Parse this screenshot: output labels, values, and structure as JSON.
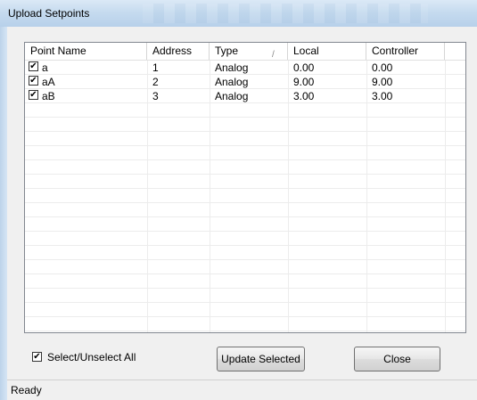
{
  "window": {
    "title": "Upload Setpoints"
  },
  "list": {
    "columns": [
      "Point Name",
      "Address",
      "Type",
      "Local",
      "Controller"
    ],
    "sort_indicator": "/",
    "rows": [
      {
        "checked": true,
        "name": "a",
        "address": "1",
        "type": "Analog",
        "local": "0.00",
        "controller": "0.00"
      },
      {
        "checked": true,
        "name": "aA",
        "address": "2",
        "type": "Analog",
        "local": "9.00",
        "controller": "9.00"
      },
      {
        "checked": true,
        "name": "aB",
        "address": "3",
        "type": "Analog",
        "local": "3.00",
        "controller": "3.00"
      }
    ]
  },
  "footer": {
    "select_all_label": "Select/Unselect All",
    "select_all_checked": true,
    "update_button": "Update Selected",
    "close_button": "Close"
  },
  "statusbar": {
    "text": "Ready"
  },
  "glyphs": {
    "check": "✔"
  }
}
